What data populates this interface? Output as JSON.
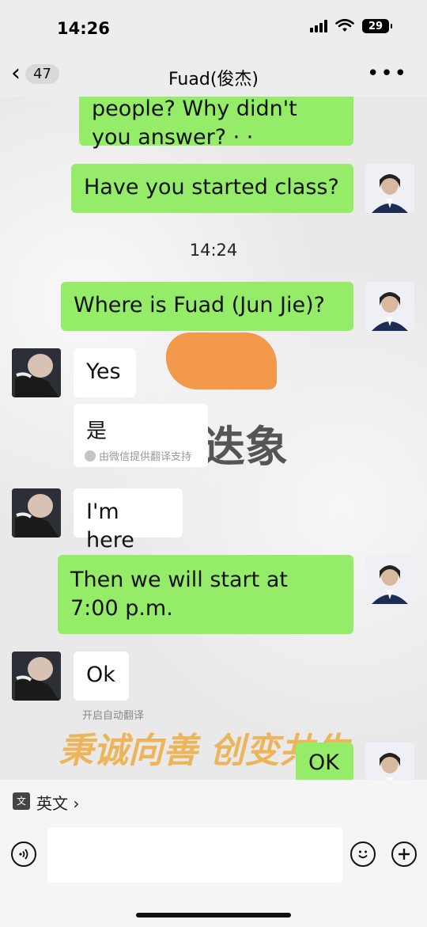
{
  "status_bar": {
    "time": "14:26",
    "battery": "29"
  },
  "nav": {
    "unread_count": "47",
    "title": "Fuad(俊杰)",
    "more": "•••"
  },
  "messages": [
    {
      "from": "me",
      "text": "people? Why didn't you answer? · ·"
    },
    {
      "from": "me",
      "text": "Have you started class?"
    },
    {
      "from": "me",
      "text": "Where is Fuad (Jun Jie)?"
    },
    {
      "from": "them",
      "text": "Yes"
    },
    {
      "from": "them",
      "text": "I'm here"
    },
    {
      "from": "me",
      "text": "Then we will start at 7:00 p.m."
    },
    {
      "from": "them",
      "text": "Ok"
    },
    {
      "from": "me",
      "text": "OK"
    }
  ],
  "timestamp": "14:24",
  "translation": {
    "text": "是",
    "note": "由微信提供翻译支持"
  },
  "auto_translate": "开启自动翻译",
  "watermark": {
    "top": "迭象",
    "bottom": "秉诚向善  创变共生"
  },
  "input": {
    "language": "英文",
    "placeholder": ""
  },
  "icons": {
    "back": "chevron-left-icon",
    "voice": "voice-icon",
    "emoji": "emoji-icon",
    "plus": "plus-icon"
  }
}
